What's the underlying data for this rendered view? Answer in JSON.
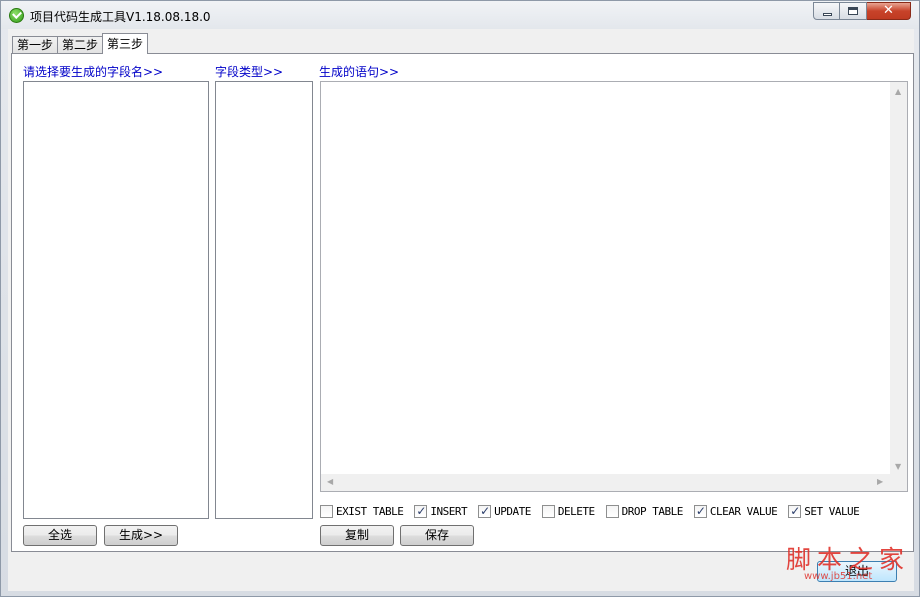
{
  "window": {
    "title": "项目代码生成工具V1.18.08.18.0",
    "min_label": "",
    "max_label": "",
    "close_label": "✕"
  },
  "tabs": [
    {
      "label": "第一步"
    },
    {
      "label": "第二步"
    },
    {
      "label": "第三步",
      "active": true
    }
  ],
  "step3": {
    "fields_label": "请选择要生成的字段名>>",
    "types_label": "字段类型>>",
    "output_label": "生成的语句>>",
    "output_value": "",
    "checkboxes": [
      {
        "label": "EXIST TABLE",
        "checked": false
      },
      {
        "label": "INSERT",
        "checked": true
      },
      {
        "label": "UPDATE",
        "checked": true
      },
      {
        "label": "DELETE",
        "checked": false
      },
      {
        "label": "DROP TABLE",
        "checked": false
      },
      {
        "label": "CLEAR VALUE",
        "checked": true
      },
      {
        "label": "SET VALUE",
        "checked": true
      }
    ],
    "select_all_button": "全选",
    "generate_button": "生成>>",
    "copy_button": "复制",
    "save_button": "保存"
  },
  "footer": {
    "exit_button": "退出"
  },
  "watermark": {
    "cn": "脚本之家",
    "en": "www.jb51.net"
  },
  "colors": {
    "label_blue": "#0000c8",
    "watermark_red": "#e0322b"
  }
}
